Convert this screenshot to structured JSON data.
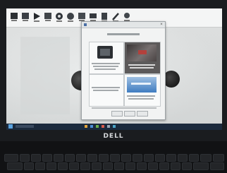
{
  "scene": {
    "brand_text": "DELL",
    "colors": {
      "bezel": "#1a1c1f",
      "screen": "#e6e8e8",
      "dialog": "#f2f3f3",
      "taskbar": "#1b2a3d",
      "keyboard": "#111214",
      "accent": "#3f7cc1"
    }
  },
  "toolbar": {
    "icons": [
      "app-icon",
      "app-icon",
      "play-icon",
      "app-icon",
      "gear-icon",
      "app-icon",
      "app-icon",
      "app-icon",
      "app-icon",
      "wrench-icon",
      "app-icon"
    ]
  },
  "dialog": {
    "icon": "window-icon",
    "close_icon": "close-icon"
  },
  "taskbar": {
    "icons": [
      "start-icon",
      "search-icon",
      "app-icon",
      "app-icon",
      "app-icon",
      "app-icon",
      "app-icon",
      "app-icon"
    ]
  }
}
